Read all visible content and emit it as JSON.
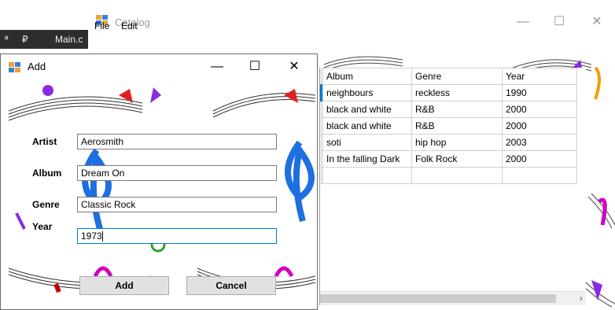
{
  "ide": {
    "tab_label": "Main.c",
    "pin_glyphs": [
      "ª",
      "₽"
    ]
  },
  "catalog": {
    "title": "Catalog",
    "menu": [
      "File",
      "Edit"
    ],
    "caption": {
      "minimize": "—",
      "maximize": "☐",
      "close": "✕"
    },
    "grid": {
      "columns": [
        "Album",
        "Genre",
        "Year"
      ],
      "rows": [
        [
          "neighbours",
          "reckless",
          "1990"
        ],
        [
          "black and white",
          "R&B",
          "2000"
        ],
        [
          "black and white",
          "R&B",
          "2000"
        ],
        [
          "soti",
          "hip hop",
          "2003"
        ],
        [
          "In the falling Dark",
          "Folk Rock",
          "2000"
        ],
        [
          "",
          "",
          ""
        ]
      ],
      "scroll_arrow": "›"
    }
  },
  "add_dialog": {
    "title": "Add",
    "caption": {
      "minimize": "—",
      "maximize": "☐",
      "close": "✕"
    },
    "fields": {
      "artist": {
        "label": "Artist",
        "value": "Aerosmith"
      },
      "album": {
        "label": "Album",
        "value": "Dream On"
      },
      "genre": {
        "label": "Genre",
        "value": "Classic Rock"
      },
      "year": {
        "label": "Year",
        "value": "1973"
      }
    },
    "buttons": {
      "add": "Add",
      "cancel": "Cancel"
    }
  },
  "colors": {
    "ide_dark": "#2d2d30",
    "focus_blue": "#0078d7",
    "row_marker": "#0078d7"
  }
}
